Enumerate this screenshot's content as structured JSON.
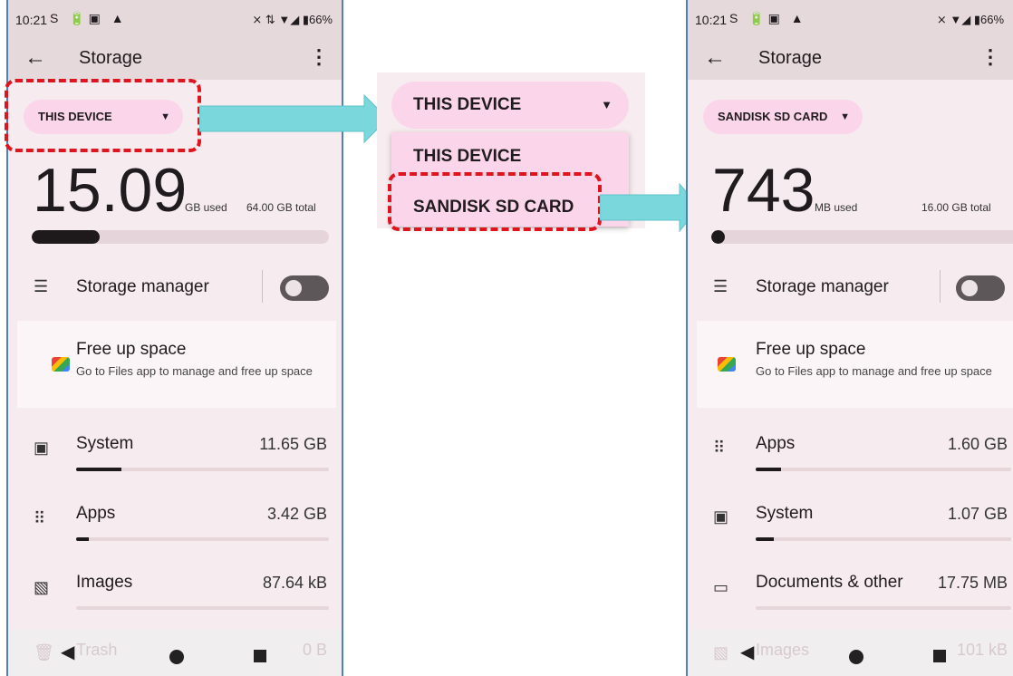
{
  "left": {
    "status": {
      "time": "10:21",
      "icons": "S 🔋▣ ▲",
      "right": "⨯ ⇅ ▼◢ ▮66%"
    },
    "appbar": {
      "back": "←",
      "title": "Storage",
      "more": "⋮"
    },
    "chip": "THIS DEVICE",
    "used_number": "15.09",
    "used_unit": "GB used",
    "total": "64.00 GB total",
    "used_fraction": 0.23,
    "storage_manager": "Storage manager",
    "free_title": "Free up space",
    "free_sub": "Go to Files app to manage and free up space",
    "rows": [
      {
        "label": "System",
        "value": "11.65 GB",
        "fraction": 0.18
      },
      {
        "label": "Apps",
        "value": "3.42 GB",
        "fraction": 0.05
      },
      {
        "label": "Images",
        "value": "87.64 kB",
        "fraction": 0.0
      }
    ],
    "faded": {
      "label": "Trash",
      "value": "0 B"
    }
  },
  "dropdown": {
    "selected": "THIS DEVICE",
    "options": [
      "THIS DEVICE",
      "SANDISK SD CARD"
    ]
  },
  "right": {
    "status": {
      "time": "10:21",
      "icons": "S 🔋▣ ▲",
      "right": "⨯ ▼◢ ▮66%"
    },
    "appbar": {
      "back": "←",
      "title": "Storage",
      "more": "⋮"
    },
    "chip": "SANDISK SD CARD",
    "used_number": "743",
    "used_unit": "MB used",
    "total": "16.00 GB total",
    "used_fraction": 0.045,
    "storage_manager": "Storage manager",
    "free_title": "Free up space",
    "free_sub": "Go to Files app to manage and free up space",
    "rows": [
      {
        "label": "Apps",
        "value": "1.60 GB",
        "fraction": 0.1
      },
      {
        "label": "System",
        "value": "1.07 GB",
        "fraction": 0.07
      },
      {
        "label": "Documents & other",
        "value": "17.75 MB",
        "fraction": 0.0
      }
    ],
    "faded": {
      "label": "Images",
      "value": "101 kB"
    }
  },
  "colors": {
    "highlight": "#e0141e",
    "arrow": "#7ad7dc",
    "chip": "#fbd6ea",
    "phone_bg": "#f6ebee",
    "frame": "#4f7fc0"
  },
  "icons": [
    "back-arrow-icon",
    "more-vert-icon",
    "dropdown-caret-icon",
    "storage-manager-icon",
    "files-app-icon",
    "system-icon",
    "apps-grid-icon",
    "images-icon",
    "documents-folder-icon",
    "trash-icon"
  ]
}
